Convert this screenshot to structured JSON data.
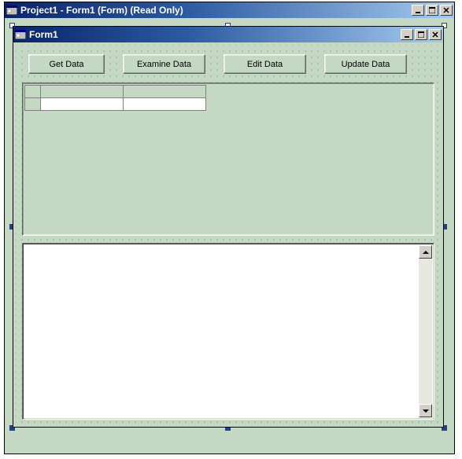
{
  "outer_window": {
    "title": "Project1 - Form1 (Form)  (Read Only)"
  },
  "inner_window": {
    "title": "Form1"
  },
  "buttons": {
    "get": "Get Data",
    "examine": "Examine Data",
    "edit": "Edit Data",
    "update": "Update Data"
  },
  "grid": {
    "cols": 3,
    "rows": 2
  },
  "textbox": {
    "value": ""
  }
}
